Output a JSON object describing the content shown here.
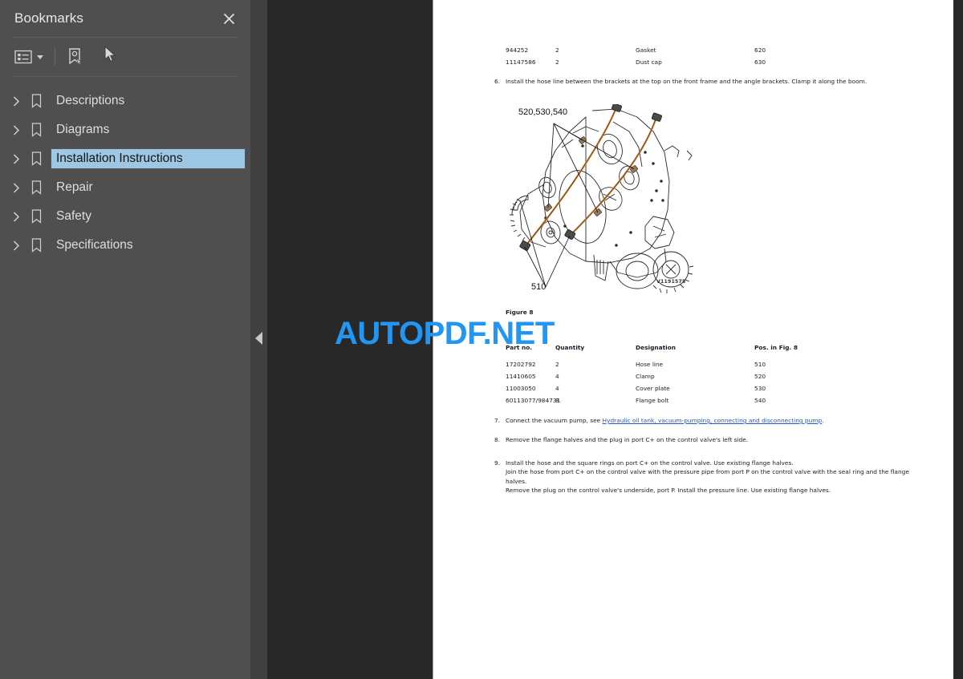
{
  "sidebar": {
    "title": "Bookmarks",
    "close_label": "Close",
    "toolbar": {
      "options_icon": "list-options-icon",
      "dropdown_icon": "chevron-down-icon",
      "new_bookmark_icon": "new-bookmark-icon",
      "cursor_icon": "mouse-pointer-icon"
    },
    "items": [
      {
        "label": "Descriptions",
        "selected": false
      },
      {
        "label": "Diagrams",
        "selected": false
      },
      {
        "label": "Installation Instructions",
        "selected": true
      },
      {
        "label": "Repair",
        "selected": false
      },
      {
        "label": "Safety",
        "selected": false
      },
      {
        "label": "Specifications",
        "selected": false
      }
    ],
    "expand_icon": "chevron-right-icon",
    "bookmark_icon": "bookmark-icon"
  },
  "divider": {
    "collapse_icon": "collapse-left-arrow-icon"
  },
  "watermark": {
    "text": "AUTOPDF.NET",
    "color": "#2196f3"
  },
  "document": {
    "top_table": {
      "rows": [
        {
          "part": "944252",
          "qty": "2",
          "designation": "Gasket",
          "pos": "620"
        },
        {
          "part": "11147586",
          "qty": "2",
          "designation": "Dust cap",
          "pos": "630"
        }
      ]
    },
    "step6": {
      "number": "6.",
      "text": "Install the hose line between the brackets at the top on the front frame and the angle brackets. Clamp it along the boom."
    },
    "figure": {
      "callout_top": "520,530,540",
      "callout_bottom": "510",
      "code": "V1191575",
      "caption": "Figure 8"
    },
    "parts_table": {
      "headers": [
        "Part no.",
        "Quantity",
        "Designation",
        "Pos. in Fig. 8"
      ],
      "rows": [
        {
          "part": "17202792",
          "qty": "2",
          "designation": "Hose line",
          "pos": "510"
        },
        {
          "part": "11410605",
          "qty": "4",
          "designation": "Clamp",
          "pos": "520"
        },
        {
          "part": "11003050",
          "qty": "4",
          "designation": "Cover plate",
          "pos": "530"
        },
        {
          "part": "60113077/984731",
          "qty": "8",
          "designation": "Flange bolt",
          "pos": "540"
        }
      ]
    },
    "step7": {
      "number": "7.",
      "text_before": "Connect the vacuum pump, see ",
      "link": "Hydraulic oil tank, vacuum-pumping, connecting and disconnecting pump",
      "text_after": "."
    },
    "step8": {
      "number": "8.",
      "text": "Remove the flange halves and the plug in port C+ on the control valve's left side."
    },
    "step9": {
      "number": "9.",
      "line1": "Install the hose and the square rings on port C+ on the control valve. Use existing flange halves.",
      "line2": "Join the hose from port C+ on the control valve with the pressure pipe from port P on the control valve with the seal ring and the flange halves.",
      "line3": "Remove the plug on the control valve's underside, port P. Install the pressure line. Use existing flange halves."
    }
  }
}
